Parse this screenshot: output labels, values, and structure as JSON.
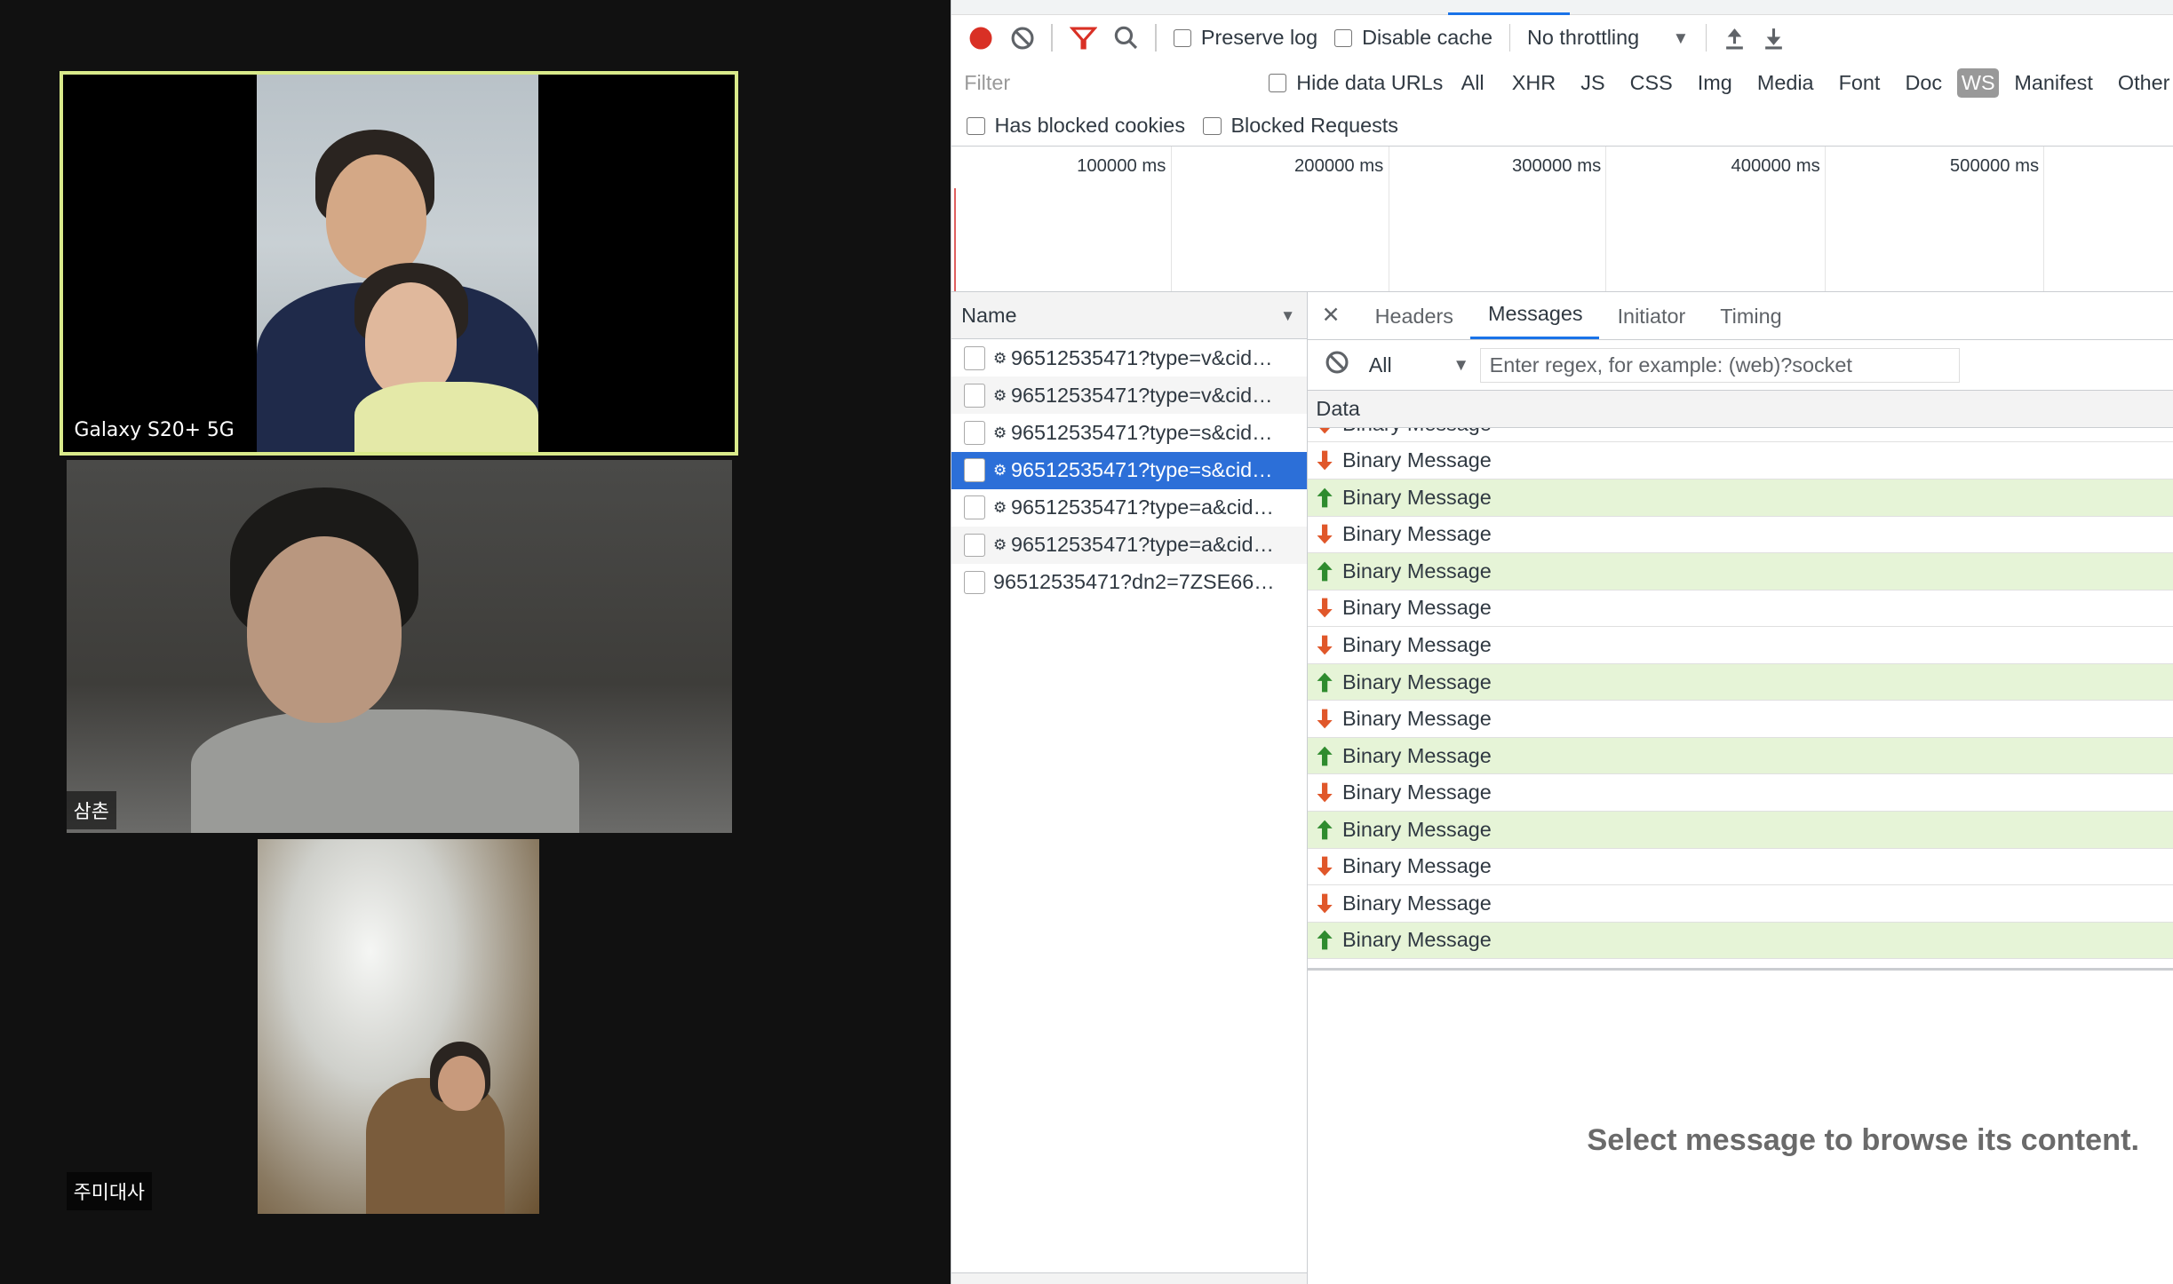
{
  "videos": [
    {
      "label": "Galaxy S20+ 5G",
      "active": true
    },
    {
      "label": "삼촌"
    },
    {
      "label": "주미대사"
    }
  ],
  "colors": {
    "active_border": "#d9ea8a",
    "selected_row": "#2c6fd8",
    "sent_row": "#e6f4d7",
    "arrow_sent": "#2e8b2e",
    "arrow_received": "#e0572a"
  },
  "toolbar": {
    "preserve_log": "Preserve log",
    "disable_cache": "Disable cache",
    "throttling": "No throttling"
  },
  "filter": {
    "placeholder": "Filter",
    "hide_data_urls": "Hide data URLs",
    "types": [
      "All",
      "XHR",
      "JS",
      "CSS",
      "Img",
      "Media",
      "Font",
      "Doc",
      "WS",
      "Manifest",
      "Other"
    ],
    "active_type": "WS",
    "has_blocked_cookies": "Has blocked cookies",
    "blocked_requests": "Blocked Requests"
  },
  "timeline": {
    "ticks": [
      "100000 ms",
      "200000 ms",
      "300000 ms",
      "400000 ms",
      "500000 ms"
    ]
  },
  "requests": {
    "header": "Name",
    "rows": [
      {
        "name": "96512535471?type=v&cid…",
        "ws": true
      },
      {
        "name": "96512535471?type=v&cid…",
        "ws": true
      },
      {
        "name": "96512535471?type=s&cid…",
        "ws": true
      },
      {
        "name": "96512535471?type=s&cid…",
        "ws": true,
        "selected": true
      },
      {
        "name": "96512535471?type=a&cid…",
        "ws": true
      },
      {
        "name": "96512535471?type=a&cid…",
        "ws": true
      },
      {
        "name": "96512535471?dn2=7ZSE66…",
        "ws": false
      }
    ]
  },
  "detail": {
    "tabs": [
      "Headers",
      "Messages",
      "Initiator",
      "Timing"
    ],
    "active_tab": "Messages",
    "msg_filter": "All",
    "regex_placeholder": "Enter regex, for example: (web)?socket",
    "data_header": "Data",
    "messages": [
      {
        "text": "Binary Message",
        "dir": "received"
      },
      {
        "text": "Binary Message",
        "dir": "received"
      },
      {
        "text": "Binary Message",
        "dir": "sent"
      },
      {
        "text": "Binary Message",
        "dir": "received"
      },
      {
        "text": "Binary Message",
        "dir": "sent"
      },
      {
        "text": "Binary Message",
        "dir": "received"
      },
      {
        "text": "Binary Message",
        "dir": "received"
      },
      {
        "text": "Binary Message",
        "dir": "sent"
      },
      {
        "text": "Binary Message",
        "dir": "received"
      },
      {
        "text": "Binary Message",
        "dir": "sent"
      },
      {
        "text": "Binary Message",
        "dir": "received"
      },
      {
        "text": "Binary Message",
        "dir": "sent"
      },
      {
        "text": "Binary Message",
        "dir": "received"
      },
      {
        "text": "Binary Message",
        "dir": "received"
      },
      {
        "text": "Binary Message",
        "dir": "sent"
      }
    ],
    "placeholder": "Select message to browse its content."
  }
}
